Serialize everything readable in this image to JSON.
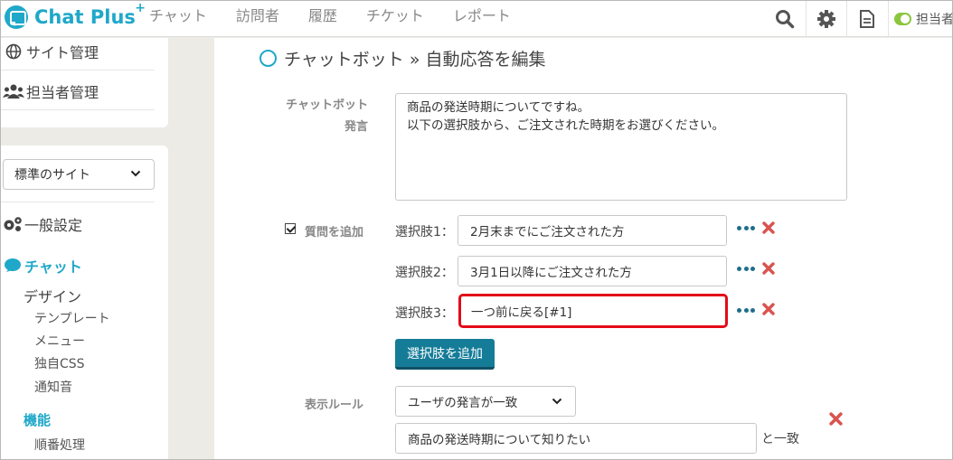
{
  "app": {
    "name": "Chat Plus",
    "plus": "+"
  },
  "nav": [
    "チャット",
    "訪問者",
    "履歴",
    "チケット",
    "レポート"
  ],
  "header": {
    "icons": [
      "search-icon",
      "gear-icon",
      "document-icon"
    ],
    "toggle_label": "担当者"
  },
  "sidebar": {
    "items_top": [
      {
        "icon": "globe-icon",
        "label": "サイト管理"
      },
      {
        "icon": "users-icon",
        "label": "担当者管理"
      }
    ],
    "site_select": "標準のサイト",
    "general": "一般設定",
    "chat": "チャット",
    "design": "デザイン",
    "design_items": [
      "テンプレート",
      "メニュー",
      "独自CSS",
      "通知音"
    ],
    "function": "機能",
    "function_items": [
      "順番処理"
    ]
  },
  "main": {
    "breadcrumb": "チャットボット » 自動応答を編集",
    "bot_label_1": "チャットボット",
    "bot_label_2": "発言",
    "bot_message_1": "商品の発送時期についてですね。",
    "bot_message_2": "以下の選択肢から、ご注文された時期をお選びください。",
    "add_question_label": "質問を追加",
    "add_question_checked": true,
    "choices": [
      {
        "label": "選択肢1：",
        "value": "2月末までにご注文された方"
      },
      {
        "label": "選択肢2：",
        "value": "3月1日以降にご注文された方"
      },
      {
        "label": "選択肢3：",
        "value": "一つ前に戻る[#1]",
        "highlighted": true
      }
    ],
    "add_choice_button": "選択肢を追加",
    "display_rule_label": "表示ルール",
    "rule_select": "ユーザの発言が一致",
    "rule_input": "商品の発送時期について知りたい",
    "match_suffix": "と一致"
  },
  "colors": {
    "brand": "#1fa8c9",
    "button": "#157c98",
    "delete": "#d9534f",
    "highlight": "#e30b17",
    "toggle": "#8cc63f"
  }
}
